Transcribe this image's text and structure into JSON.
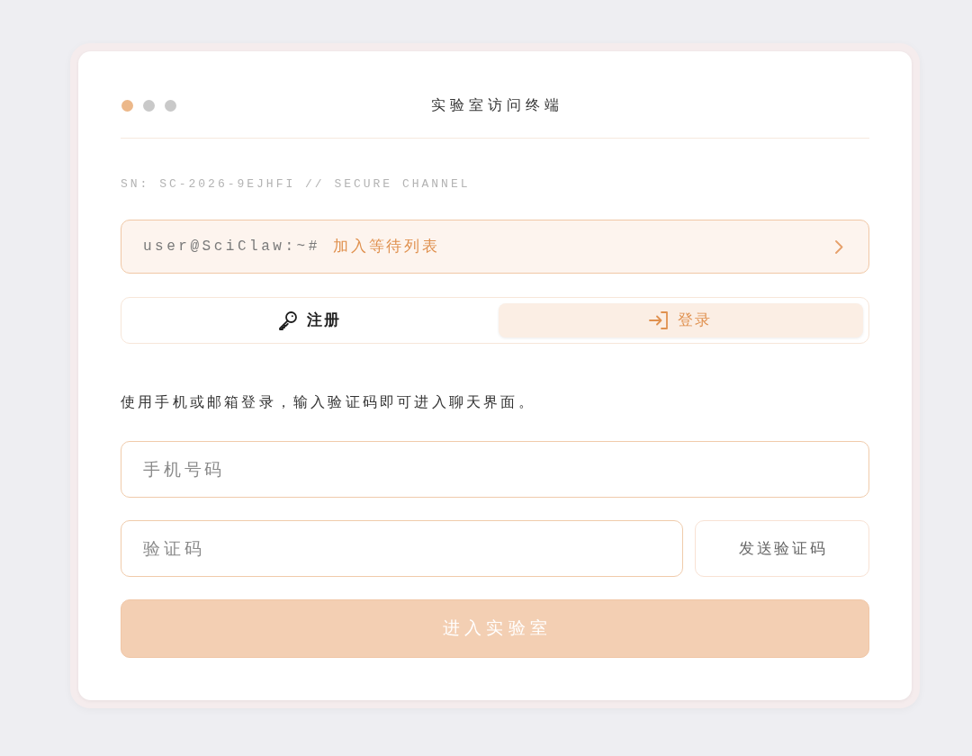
{
  "window": {
    "title": "实验室访问终端",
    "dots": [
      {
        "color": "#ecb88a"
      },
      {
        "color": "#c9c9c9"
      },
      {
        "color": "#c9c9c9"
      }
    ]
  },
  "serial": "SN: SC-2026-9EJHFI // SECURE CHANNEL",
  "terminal": {
    "prompt": "user@SciClaw:~#",
    "command": "加入等待列表"
  },
  "tabs": [
    {
      "label": "注册",
      "kind": "register",
      "selected": false
    },
    {
      "label": "登录",
      "kind": "login",
      "selected": true
    }
  ],
  "description": "使用手机或邮箱登录，输入验证码即可进入聊天界面。",
  "fields": [
    {
      "placeholder": "手机号码"
    },
    {
      "placeholder": "验证码"
    }
  ],
  "send_code_button": "发送验证码",
  "submit_button": {
    "label": "进入实验室",
    "disabled": true
  }
}
